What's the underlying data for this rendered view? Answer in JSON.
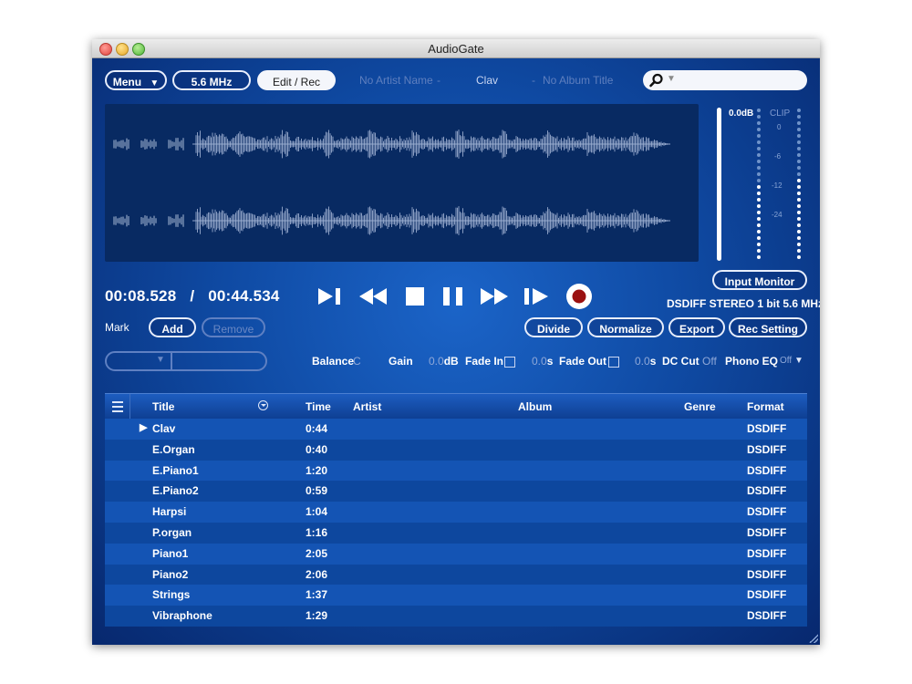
{
  "window": {
    "title": "AudioGate"
  },
  "toolbar": {
    "menu_label": "Menu",
    "rate_label": "5.6 MHz",
    "edit_rec_label": "Edit / Rec",
    "artist": "No Artist Name",
    "separator": "-",
    "track": "Clav",
    "album": "No Album Title",
    "search_placeholder": ""
  },
  "meter": {
    "peak_label": "0.0dB",
    "clip_label": "CLIP",
    "scale": [
      "0",
      "-6",
      "-12",
      "-24"
    ],
    "input_monitor_label": "Input Monitor"
  },
  "transport": {
    "position": "00:08.528",
    "divider": "/",
    "duration": "00:44.534",
    "format_info": "DSDIFF STEREO 1 bit 5.6 MHz"
  },
  "mark": {
    "label": "Mark",
    "add_label": "Add",
    "remove_label": "Remove"
  },
  "edit_buttons": {
    "divide": "Divide",
    "normalize": "Normalize",
    "export": "Export",
    "rec_setting": "Rec Setting"
  },
  "settings": {
    "balance_label": "Balance",
    "balance_value": "C",
    "gain_label": "Gain",
    "gain_value": "0.0",
    "gain_unit": "dB",
    "fade_in_label": "Fade In",
    "fade_in_value": "0.0",
    "fade_in_unit": "s",
    "fade_out_label": "Fade Out",
    "fade_out_value": "0.0",
    "fade_out_unit": "s",
    "dc_cut_label": "DC Cut",
    "dc_cut_value": "Off",
    "phono_eq_label": "Phono EQ",
    "phono_eq_value": "Off"
  },
  "playlist": {
    "columns": [
      "Title",
      "Time",
      "Artist",
      "Album",
      "Genre",
      "Format"
    ],
    "rows": [
      {
        "title": "Clav",
        "time": "0:44",
        "format": "DSDIFF"
      },
      {
        "title": "E.Organ",
        "time": "0:40",
        "format": "DSDIFF"
      },
      {
        "title": "E.Piano1",
        "time": "1:20",
        "format": "DSDIFF"
      },
      {
        "title": "E.Piano2",
        "time": "0:59",
        "format": "DSDIFF"
      },
      {
        "title": "Harpsi",
        "time": "1:04",
        "format": "DSDIFF"
      },
      {
        "title": "P.organ",
        "time": "1:16",
        "format": "DSDIFF"
      },
      {
        "title": "Piano1",
        "time": "2:05",
        "format": "DSDIFF"
      },
      {
        "title": "Piano2",
        "time": "2:06",
        "format": "DSDIFF"
      },
      {
        "title": "Strings",
        "time": "1:37",
        "format": "DSDIFF"
      },
      {
        "title": "Vibraphone",
        "time": "1:29",
        "format": "DSDIFF"
      }
    ]
  },
  "colors": {
    "accent": "#0f4aa3",
    "record": "#9a1010"
  }
}
